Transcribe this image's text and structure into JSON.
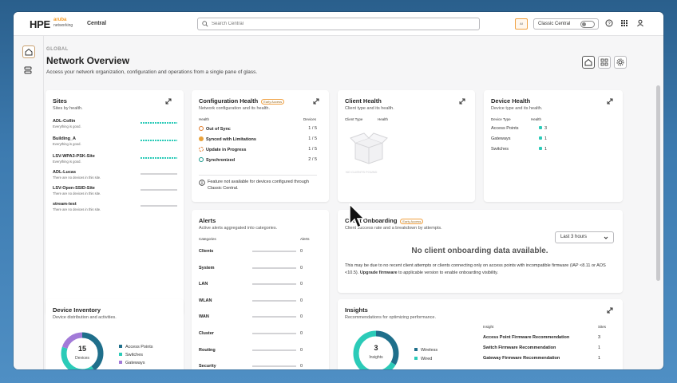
{
  "topbar": {
    "logo": "HPE",
    "logo_brand": "aruba",
    "logo_brand_sub": "networking",
    "app_name": "Central",
    "search_placeholder": "Search Central",
    "ai_badge": "AI",
    "classic_label": "Classic Central"
  },
  "page": {
    "breadcrumb": "GLOBAL",
    "title": "Network Overview",
    "subtitle": "Access your network organization, configuration and operations from a single pane of glass."
  },
  "sites": {
    "title": "Sites",
    "subtitle": "Sites by health.",
    "items": [
      {
        "name": "ADL-Collin",
        "note": "Everything is good."
      },
      {
        "name": "Building_A",
        "note": "Everything is good."
      },
      {
        "name": "LSV-WPA3-PSK-Site",
        "note": "Everything is good."
      },
      {
        "name": "ADL-Lucas",
        "note": "There are no devices in this site."
      },
      {
        "name": "LSV-Open-SSID-Site",
        "note": "There are no devices in this site."
      },
      {
        "name": "stream-test",
        "note": "There are no devices in this site."
      }
    ]
  },
  "config": {
    "title": "Configuration Health",
    "beta": "Early Access",
    "subtitle": "Network configuration and its health.",
    "col_health": "Health",
    "col_devices": "Devices",
    "rows": [
      {
        "label": "Out of Sync",
        "value": "1 / 5",
        "color": "#e07b2a"
      },
      {
        "label": "Synced with Limitations",
        "value": "1 / 5",
        "color": "#e9a23b"
      },
      {
        "label": "Update in Progress",
        "value": "1 / 5",
        "color": "#e07b2a"
      },
      {
        "label": "Synchronized",
        "value": "2 / 5",
        "color": "#1f9b8e"
      }
    ],
    "info": "Feature not available for devices configured through Classic Central."
  },
  "client_health": {
    "title": "Client Health",
    "subtitle": "Client type and its health.",
    "col_type": "Client Type",
    "col_health": "Health",
    "empty": "NO CLIENTS FOUND"
  },
  "device_health": {
    "title": "Device Health",
    "subtitle": "Device type and its health.",
    "col_type": "Device Type",
    "col_health": "Health",
    "rows": [
      {
        "label": "Access Points",
        "value": "3"
      },
      {
        "label": "Gateways",
        "value": "1"
      },
      {
        "label": "Switches",
        "value": "1"
      }
    ]
  },
  "alerts": {
    "title": "Alerts",
    "subtitle": "Active alerts aggregated into categories.",
    "col_categories": "Categories",
    "col_alerts": "Alerts",
    "rows": [
      {
        "label": "Clients",
        "value": "0"
      },
      {
        "label": "System",
        "value": "0"
      },
      {
        "label": "LAN",
        "value": "0"
      },
      {
        "label": "WLAN",
        "value": "0"
      },
      {
        "label": "WAN",
        "value": "0"
      },
      {
        "label": "Cluster",
        "value": "0"
      },
      {
        "label": "Routing",
        "value": "0"
      },
      {
        "label": "Security",
        "value": "0"
      }
    ]
  },
  "onboarding": {
    "title": "Client Onboarding",
    "beta": "Early Access",
    "subtitle": "Client success rate and a breakdown by attempts.",
    "time_select": "Last 3 hours",
    "no_data": "No client onboarding data available.",
    "note_pre": "This may be due to no recent client attempts or clients connecting only on access points with incompatible firmware (IAP <8.11 or AOS <10.5).",
    "note_link": "Upgrade firmware",
    "note_post": "to applicable version to enable onboarding visibility."
  },
  "inventory": {
    "title": "Device Inventory",
    "subtitle": "Device distribution and activities.",
    "total": "15",
    "total_label": "Devices",
    "legend": [
      {
        "label": "Access Points",
        "color": "#1f6f8b"
      },
      {
        "label": "Switches",
        "color": "#2bcbb8"
      },
      {
        "label": "Gateways",
        "color": "#a27ad8"
      }
    ]
  },
  "insights": {
    "title": "Insights",
    "subtitle": "Recommendations for optimizing performance.",
    "total": "3",
    "total_label": "Insights",
    "legend": [
      {
        "label": "Wireless",
        "color": "#1f6f8b"
      },
      {
        "label": "Wired",
        "color": "#2bcbb8"
      }
    ],
    "col_insight": "Insight",
    "col_sites": "Sites",
    "rows": [
      {
        "label": "Access Point Firmware Recommendation",
        "value": "3"
      },
      {
        "label": "Switch Firmware Recommendation",
        "value": "1"
      },
      {
        "label": "Gateway Firmware Recommendation",
        "value": "1"
      }
    ]
  },
  "colors": {
    "accent_teal": "#2bcbb8",
    "accent_dark": "#1f6f8b",
    "accent_orange": "#f59a23"
  }
}
